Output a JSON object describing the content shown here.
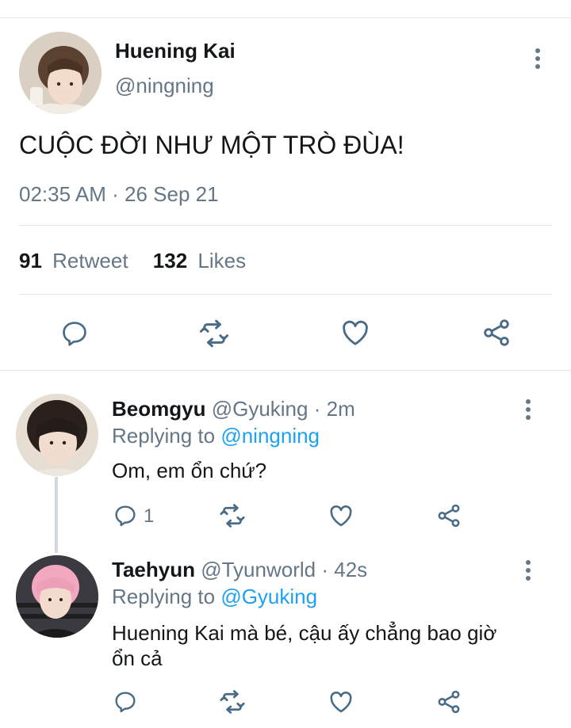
{
  "tweet": {
    "name": "Huening Kai",
    "handle": "@ningning",
    "text": "CUỘC ĐỜI NHƯ MỘT TRÒ ĐÙA!",
    "time": "02:35 AM",
    "separator": "·",
    "date": "26 Sep 21",
    "retweet_count": "91",
    "retweet_label": "Retweet",
    "likes_count": "132",
    "likes_label": "Likes"
  },
  "replies": [
    {
      "name": "Beomgyu",
      "handle": "@Gyuking",
      "dot": "·",
      "time": "2m",
      "replying_label": "Replying to",
      "replying_to": "@ningning",
      "text": "Om, em ổn chứ?",
      "reply_count": "1"
    },
    {
      "name": "Taehyun",
      "handle": "@Tyunworld",
      "dot": "·",
      "time": "42s",
      "replying_label": "Replying to",
      "replying_to": "@Gyuking",
      "text": "Huening Kai mà bé, cậu ấy chẳng bao giờ ổn cả"
    }
  ],
  "icons": [
    "more-vertical-icon",
    "reply-icon",
    "retweet-icon",
    "like-icon",
    "share-icon"
  ],
  "colors": {
    "link": "#1da1f2",
    "muted": "#657786",
    "icon": "#4a6b85",
    "divider": "#e1e6ea"
  }
}
